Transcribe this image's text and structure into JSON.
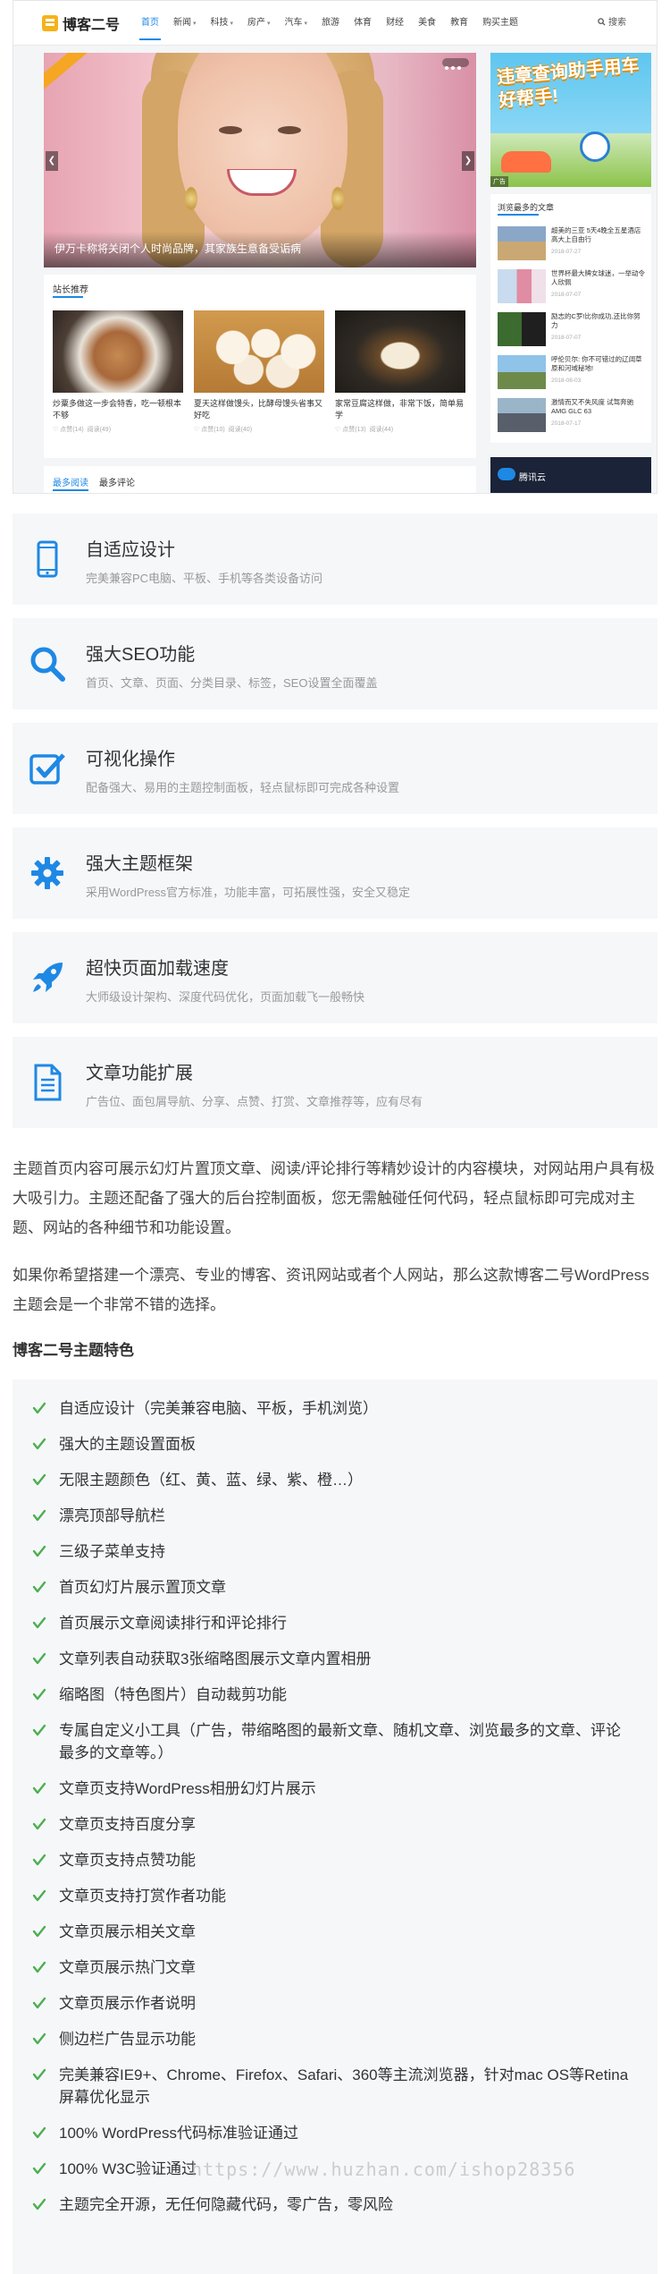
{
  "preview": {
    "logo_text": "博客二号",
    "nav": [
      {
        "label": "首页",
        "caret": false,
        "active": true
      },
      {
        "label": "新闻",
        "caret": true
      },
      {
        "label": "科技",
        "caret": true
      },
      {
        "label": "房产",
        "caret": true
      },
      {
        "label": "汽车",
        "caret": true
      },
      {
        "label": "旅游",
        "caret": false
      },
      {
        "label": "体育",
        "caret": false
      },
      {
        "label": "财经",
        "caret": false
      },
      {
        "label": "美食",
        "caret": false
      },
      {
        "label": "教育",
        "caret": false
      },
      {
        "label": "购买主题",
        "caret": false
      }
    ],
    "search_label": "搜索",
    "slider_caption": "伊万卡称将关闭个人时尚品牌，其家族生意备受诟病",
    "recommend_title": "站长推荐",
    "recommend_items": [
      {
        "title": "炒粟多做这一步会特香，吃一顿根本不够",
        "views": "点赞(14)",
        "reads": "阅读(49)",
        "image": "noodle-photo"
      },
      {
        "title": "夏天这样做馒头，比酵母馒头省事又好吃",
        "views": "点赞(10)",
        "reads": "阅读(40)",
        "image": "buns-photo"
      },
      {
        "title": "家常豆腐这样做，非常下饭，简单易学",
        "views": "点赞(13)",
        "reads": "阅读(44)",
        "image": "tofu-photo"
      }
    ],
    "tabs": [
      "最多阅读",
      "最多评论"
    ],
    "ad_text": "违章查询助手用车好帮手!",
    "ad_tag": "广告",
    "hot_title": "浏览最多的文章",
    "hot_items": [
      {
        "title": "超美的三亚 5天4晚全五星酒店高大上自由行",
        "date": "2018-07-27"
      },
      {
        "title": "世界杯最大牌女球迷，一举动令人欣佩",
        "date": "2018-07-07"
      },
      {
        "title": "励志的C罗!比你成功,还比你努力",
        "date": "2018-07-07"
      },
      {
        "title": "呼伦贝尔: 你不可错过的辽阔草原和河域秘地!",
        "date": "2018-08-03"
      },
      {
        "title": "激情而又不失风度 试驾奔驰AMG GLC 63",
        "date": "2018-07-17"
      }
    ],
    "cloud_ad_text": "腾讯云"
  },
  "features": [
    {
      "title": "自适应设计",
      "desc": "完美兼容PC电脑、平板、手机等各类设备访问",
      "icon": "mobile-phone-icon"
    },
    {
      "title": "强大SEO功能",
      "desc": "首页、文章、页面、分类目录、标签，SEO设置全面覆盖",
      "icon": "magnifier-icon"
    },
    {
      "title": "可视化操作",
      "desc": "配备强大、易用的主题控制面板，轻点鼠标即可完成各种设置",
      "icon": "checkbox-icon"
    },
    {
      "title": "强大主题框架",
      "desc": "采用WordPress官方标准，功能丰富，可拓展性强，安全又稳定",
      "icon": "gear-icon"
    },
    {
      "title": "超快页面加载速度",
      "desc": "大师级设计架构、深度代码优化，页面加载飞一般畅快",
      "icon": "rocket-icon"
    },
    {
      "title": "文章功能扩展",
      "desc": "广告位、面包屑导航、分享、点赞、打赏、文章推荐等，应有尽有",
      "icon": "document-icon"
    }
  ],
  "article": {
    "para1": "主题首页内容可展示幻灯片置顶文章、阅读/评论排行等精妙设计的内容模块，对网站用户具有极大吸引力。主题还配备了强大的后台控制面板，您无需触碰任何代码，轻点鼠标即可完成对主题、网站的各种细节和功能设置。",
    "para2": "如果你希望搭建一个漂亮、专业的博客、资讯网站或者个人网站，那么这款博客二号WordPress主题会是一个非常不错的选择。",
    "features_heading": "博客二号主题特色",
    "checklist": [
      "自适应设计（完美兼容电脑、平板，手机浏览）",
      "强大的主题设置面板",
      "无限主题颜色（红、黄、蓝、绿、紫、橙…）",
      "漂亮顶部导航栏",
      "三级子菜单支持",
      "首页幻灯片展示置顶文章",
      "首页展示文章阅读排行和评论排行",
      "文章列表自动获取3张缩略图展示文章内置相册",
      "缩略图（特色图片）自动裁剪功能",
      "专属自定义小工具（广告，带缩略图的最新文章、随机文章、浏览最多的文章、评论最多的文章等。）",
      "文章页支持WordPress相册幻灯片展示",
      "文章页支持百度分享",
      "文章页支持点赞功能",
      "文章页支持打赏作者功能",
      "文章页展示相关文章",
      "文章页展示热门文章",
      "文章页展示作者说明",
      "侧边栏广告显示功能",
      "完美兼容IE9+、Chrome、Firefox、Safari、360等主流浏览器，针对mac OS等Retina屏幕优化显示",
      "100% WordPress代码标准验证通过",
      "100% W3C验证通过",
      "主题完全开源，无任何隐藏代码，零广告，零风险"
    ],
    "watermark": "https://www.huzhan.com/ishop28356"
  },
  "colors": {
    "accent": "#1e88e5",
    "check": "#4caf50",
    "card_bg": "#f6f7f9"
  }
}
